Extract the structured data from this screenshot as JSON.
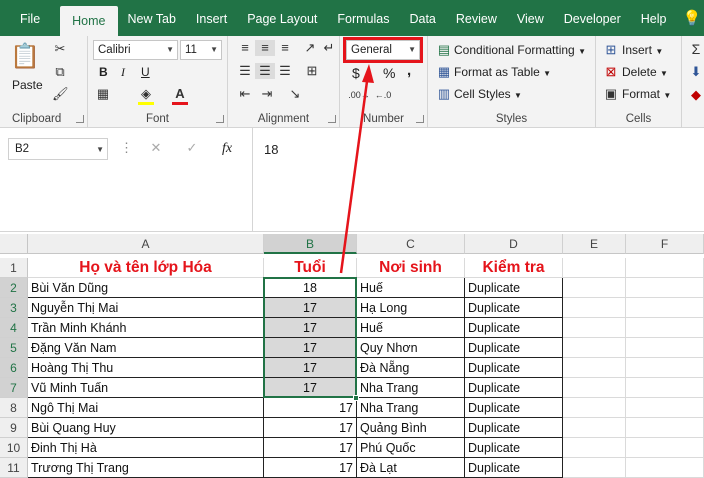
{
  "ribbon_tabs": [
    "File",
    "Home",
    "New Tab",
    "Insert",
    "Page Layout",
    "Formulas",
    "Data",
    "Review",
    "View",
    "Developer",
    "Help"
  ],
  "clipboard": {
    "paste": "Paste",
    "label": "Clipboard"
  },
  "font": {
    "name": "Calibri",
    "size": "11",
    "label": "Font",
    "bold": "B",
    "italic": "I",
    "underline": "U"
  },
  "alignment": {
    "label": "Alignment"
  },
  "number": {
    "format": "General",
    "label": "Number",
    "currency": "$",
    "percent": "%",
    "comma": ","
  },
  "styles": {
    "conditional": "Conditional Formatting",
    "table": "Format as Table",
    "cell": "Cell Styles",
    "label": "Styles"
  },
  "cells": {
    "insert": "Insert",
    "delete": "Delete",
    "format": "Format",
    "label": "Cells"
  },
  "formula": {
    "namebox": "B2",
    "value": "18",
    "fx": "fx"
  },
  "columns": [
    "A",
    "B",
    "C",
    "D",
    "E",
    "F"
  ],
  "rows": [
    {
      "n": "1",
      "a": "Họ và tên lớp Hóa",
      "b": "Tuổi",
      "c": "Nơi sinh",
      "d": "Kiểm tra"
    },
    {
      "n": "2",
      "a": "Bùi Văn Dũng",
      "b": "18",
      "c": "Huế",
      "d": "Duplicate"
    },
    {
      "n": "3",
      "a": "Nguyễn Thị Mai",
      "b": "17",
      "c": "Hạ Long",
      "d": "Duplicate"
    },
    {
      "n": "4",
      "a": "Trần Minh Khánh",
      "b": "17",
      "c": "Huế",
      "d": "Duplicate"
    },
    {
      "n": "5",
      "a": "Đặng Văn Nam",
      "b": "17",
      "c": "Quy Nhơn",
      "d": "Duplicate"
    },
    {
      "n": "6",
      "a": "Hoàng Thị Thu",
      "b": "17",
      "c": "Đà Nẵng",
      "d": "Duplicate"
    },
    {
      "n": "7",
      "a": "Vũ Minh Tuấn",
      "b": "17",
      "c": "Nha Trang",
      "d": "Duplicate"
    },
    {
      "n": "8",
      "a": "Ngô Thị Mai",
      "b": "17",
      "c": "Nha Trang",
      "d": "Duplicate"
    },
    {
      "n": "9",
      "a": "Bùi Quang Huy",
      "b": "17",
      "c": "Quảng Bình",
      "d": "Duplicate"
    },
    {
      "n": "10",
      "a": "Đinh Thị Hà",
      "b": "17",
      "c": "Phú Quốc",
      "d": "Duplicate"
    },
    {
      "n": "11",
      "a": "Trương Thị Trang",
      "b": "17",
      "c": "Đà Lạt",
      "d": "Duplicate"
    }
  ],
  "colors": {
    "accent": "#217346",
    "header_text": "#e5141b",
    "highlight": "#e5141b"
  }
}
